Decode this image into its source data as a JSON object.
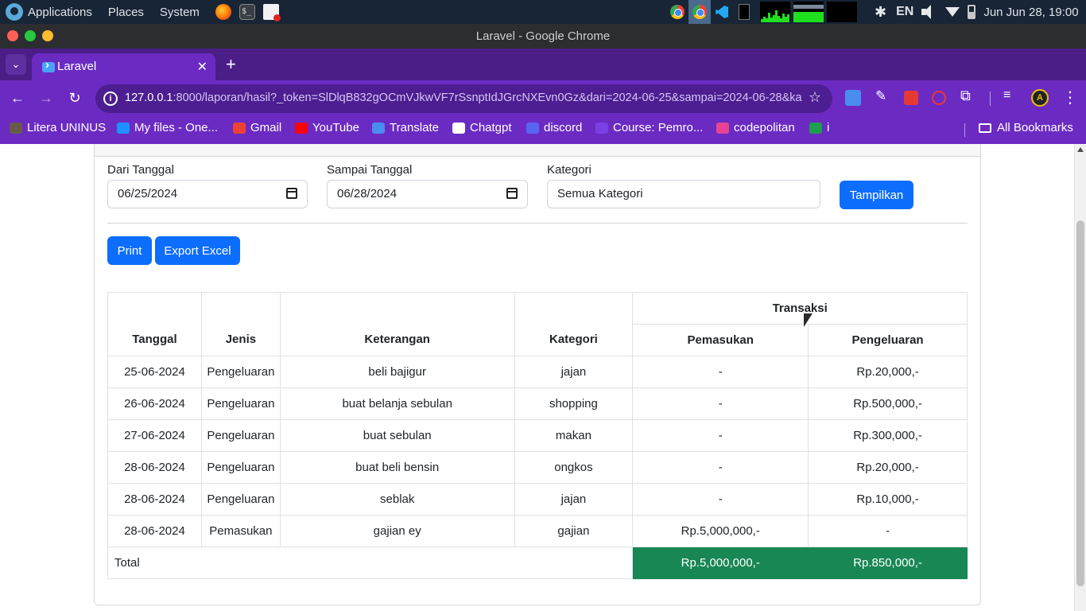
{
  "os": {
    "menus": [
      "Applications",
      "Places",
      "System"
    ],
    "lang": "EN",
    "clock": "Jun Jun 28, 19:00"
  },
  "window": {
    "title": "Laravel - Google Chrome"
  },
  "tabs": [
    {
      "title": "Laravel"
    }
  ],
  "address_bar": {
    "host": "127.0.0.1",
    "path": ":8000/laporan/hasil?_token=SlDlqB832gOCmVJkwVF7rSsnptIdJGrcNXEvn0Gz&dari=2024-06-25&sampai=2024-06-28&kate..."
  },
  "bookmarks": [
    {
      "label": "Litera UNINUS",
      "icon_color": "#6a5a4a"
    },
    {
      "label": "My files - One...",
      "icon_color": "#1f8fff"
    },
    {
      "label": "Gmail",
      "icon_color": "#ea4335"
    },
    {
      "label": "YouTube",
      "icon_color": "#ff0000"
    },
    {
      "label": "Translate",
      "icon_color": "#4a8cf0"
    },
    {
      "label": "Chatgpt",
      "icon_color": "#ffffff"
    },
    {
      "label": "discord",
      "icon_color": "#5865f2"
    },
    {
      "label": "Course: Pemro...",
      "icon_color": "#7b3fe4"
    },
    {
      "label": "codepolitan",
      "icon_color": "#e84393"
    },
    {
      "label": "i",
      "icon_color": "#1e9e50"
    }
  ],
  "all_bookmarks": "All Bookmarks",
  "form": {
    "from_label": "Dari Tanggal",
    "from_value": "06/25/2024",
    "to_label": "Sampai Tanggal",
    "to_value": "06/28/2024",
    "category_label": "Kategori",
    "category_value": "Semua Kategori",
    "submit_label": "Tampilkan"
  },
  "actions": {
    "print_label": "Print",
    "export_label": "Export Excel"
  },
  "table": {
    "headers": {
      "tanggal": "Tanggal",
      "jenis": "Jenis",
      "keterangan": "Keterangan",
      "kategori": "Kategori",
      "transaksi": "Transaksi",
      "pemasukan": "Pemasukan",
      "pengeluaran": "Pengeluaran"
    },
    "rows": [
      {
        "tanggal": "25-06-2024",
        "jenis": "Pengeluaran",
        "keterangan": "beli bajigur",
        "kategori": "jajan",
        "pemasukan": "-",
        "pengeluaran": "Rp.20,000,-"
      },
      {
        "tanggal": "26-06-2024",
        "jenis": "Pengeluaran",
        "keterangan": "buat belanja sebulan",
        "kategori": "shopping",
        "pemasukan": "-",
        "pengeluaran": "Rp.500,000,-"
      },
      {
        "tanggal": "27-06-2024",
        "jenis": "Pengeluaran",
        "keterangan": "buat sebulan",
        "kategori": "makan",
        "pemasukan": "-",
        "pengeluaran": "Rp.300,000,-"
      },
      {
        "tanggal": "28-06-2024",
        "jenis": "Pengeluaran",
        "keterangan": "buat beli bensin",
        "kategori": "ongkos",
        "pemasukan": "-",
        "pengeluaran": "Rp.20,000,-"
      },
      {
        "tanggal": "28-06-2024",
        "jenis": "Pengeluaran",
        "keterangan": "seblak",
        "kategori": "jajan",
        "pemasukan": "-",
        "pengeluaran": "Rp.10,000,-"
      },
      {
        "tanggal": "28-06-2024",
        "jenis": "Pemasukan",
        "keterangan": "gajian ey",
        "kategori": "gajian",
        "pemasukan": "Rp.5,000,000,-",
        "pengeluaran": "-"
      }
    ],
    "total": {
      "label": "Total",
      "pemasukan": "Rp.5,000,000,-",
      "pengeluaran": "Rp.850,000,-"
    }
  },
  "colors": {
    "primary": "#0d6efd",
    "success": "#198754",
    "chrome_theme": "#6b2bc2"
  }
}
